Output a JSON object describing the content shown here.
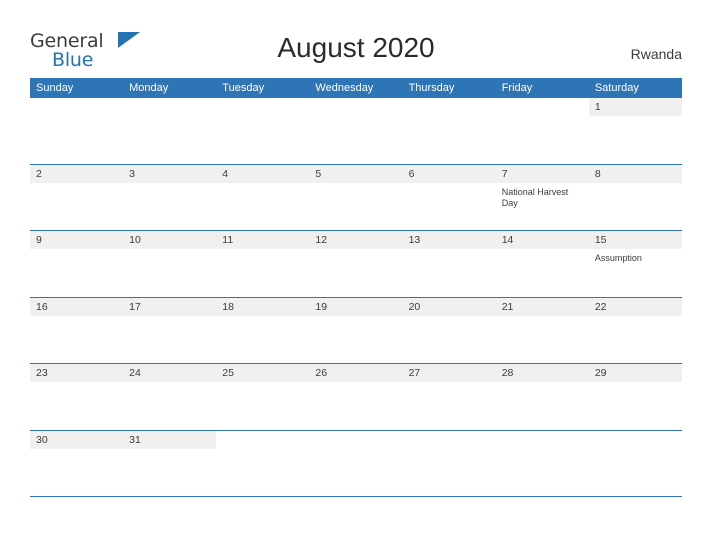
{
  "logo": {
    "general": "General",
    "blue": "Blue",
    "flag_icon": "flag-icon"
  },
  "header": {
    "title": "August 2020",
    "country": "Rwanda"
  },
  "calendar": {
    "weekdays": [
      "Sunday",
      "Monday",
      "Tuesday",
      "Wednesday",
      "Thursday",
      "Friday",
      "Saturday"
    ],
    "weeks": [
      [
        {
          "day": "",
          "event": "",
          "filled": false
        },
        {
          "day": "",
          "event": "",
          "filled": false
        },
        {
          "day": "",
          "event": "",
          "filled": false
        },
        {
          "day": "",
          "event": "",
          "filled": false
        },
        {
          "day": "",
          "event": "",
          "filled": false
        },
        {
          "day": "",
          "event": "",
          "filled": false
        },
        {
          "day": "1",
          "event": "",
          "filled": true
        }
      ],
      [
        {
          "day": "2",
          "event": "",
          "filled": true
        },
        {
          "day": "3",
          "event": "",
          "filled": true
        },
        {
          "day": "4",
          "event": "",
          "filled": true
        },
        {
          "day": "5",
          "event": "",
          "filled": true
        },
        {
          "day": "6",
          "event": "",
          "filled": true
        },
        {
          "day": "7",
          "event": "National Harvest Day",
          "filled": true
        },
        {
          "day": "8",
          "event": "",
          "filled": true
        }
      ],
      [
        {
          "day": "9",
          "event": "",
          "filled": true
        },
        {
          "day": "10",
          "event": "",
          "filled": true
        },
        {
          "day": "11",
          "event": "",
          "filled": true
        },
        {
          "day": "12",
          "event": "",
          "filled": true
        },
        {
          "day": "13",
          "event": "",
          "filled": true
        },
        {
          "day": "14",
          "event": "",
          "filled": true
        },
        {
          "day": "15",
          "event": "Assumption",
          "filled": true
        }
      ],
      [
        {
          "day": "16",
          "event": "",
          "filled": true
        },
        {
          "day": "17",
          "event": "",
          "filled": true
        },
        {
          "day": "18",
          "event": "",
          "filled": true
        },
        {
          "day": "19",
          "event": "",
          "filled": true
        },
        {
          "day": "20",
          "event": "",
          "filled": true
        },
        {
          "day": "21",
          "event": "",
          "filled": true
        },
        {
          "day": "22",
          "event": "",
          "filled": true
        }
      ],
      [
        {
          "day": "23",
          "event": "",
          "filled": true
        },
        {
          "day": "24",
          "event": "",
          "filled": true
        },
        {
          "day": "25",
          "event": "",
          "filled": true
        },
        {
          "day": "26",
          "event": "",
          "filled": true
        },
        {
          "day": "27",
          "event": "",
          "filled": true
        },
        {
          "day": "28",
          "event": "",
          "filled": true
        },
        {
          "day": "29",
          "event": "",
          "filled": true
        }
      ],
      [
        {
          "day": "30",
          "event": "",
          "filled": true
        },
        {
          "day": "31",
          "event": "",
          "filled": true
        },
        {
          "day": "",
          "event": "",
          "filled": false
        },
        {
          "day": "",
          "event": "",
          "filled": false
        },
        {
          "day": "",
          "event": "",
          "filled": false
        },
        {
          "day": "",
          "event": "",
          "filled": false
        },
        {
          "day": "",
          "event": "",
          "filled": false
        }
      ]
    ]
  },
  "colors": {
    "header_blue": "#2e75b6",
    "shade_gray": "#f0f0f0",
    "text": "#3c3c3c"
  }
}
